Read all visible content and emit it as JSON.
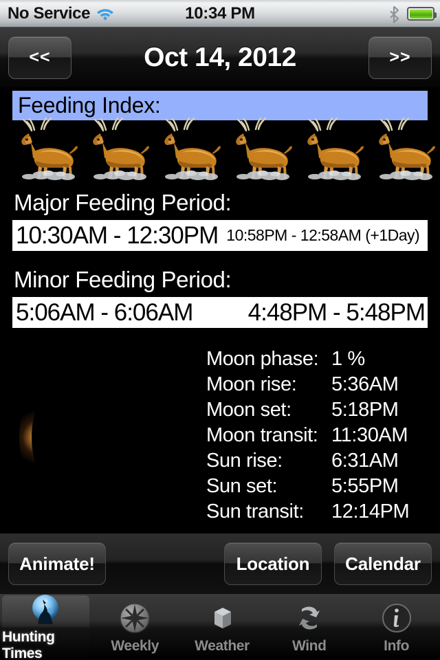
{
  "statusbar": {
    "carrier": "No Service",
    "clock": "10:34 PM",
    "wifi_icon": "wifi-icon",
    "bluetooth_icon": "bluetooth-icon",
    "battery_icon": "battery-full-icon"
  },
  "navbar": {
    "prev_label": "<<",
    "title": "Oct 14, 2012",
    "next_label": ">>"
  },
  "feeding": {
    "index_label": "Feeding Index:",
    "index_count": 6,
    "deer_icon": "deer-icon",
    "major_label": "Major Feeding Period:",
    "major_primary": "10:30AM - 12:30PM",
    "major_secondary": "10:58PM - 12:58AM (+1Day)",
    "minor_label": "Minor Feeding Period:",
    "minor_first": "5:06AM - 6:06AM",
    "minor_second": "4:48PM - 5:48PM"
  },
  "moon_image": {
    "icon": "crescent-moon-image",
    "phase_description": "waning crescent"
  },
  "astro": [
    {
      "key": "Moon phase:",
      "value": "1 %"
    },
    {
      "key": "Moon rise:",
      "value": "5:36AM"
    },
    {
      "key": "Moon set:",
      "value": "5:18PM"
    },
    {
      "key": "Moon transit:",
      "value": "11:30AM"
    },
    {
      "key": "Sun rise:",
      "value": "6:31AM"
    },
    {
      "key": "Sun set:",
      "value": "5:55PM"
    },
    {
      "key": "Sun transit:",
      "value": "12:14PM"
    }
  ],
  "buttons": {
    "animate": "Animate!",
    "location": "Location",
    "calendar": "Calendar"
  },
  "tabs": [
    {
      "label": "Hunting Times",
      "icon": "wolf-moon-icon",
      "active": true
    },
    {
      "label": "Weekly",
      "icon": "compass-rose-icon",
      "active": false
    },
    {
      "label": "Weather",
      "icon": "cloud-cube-icon",
      "active": false
    },
    {
      "label": "Wind",
      "icon": "wind-arrows-icon",
      "active": false
    },
    {
      "label": "Info",
      "icon": "info-circle-icon",
      "active": false
    }
  ],
  "colors": {
    "index_banner": "#95b0fc",
    "time_box_bg": "#ffffff",
    "page_bg": "#000000",
    "battery_green": "#63c215",
    "moon_amber": "#d99b4d"
  }
}
